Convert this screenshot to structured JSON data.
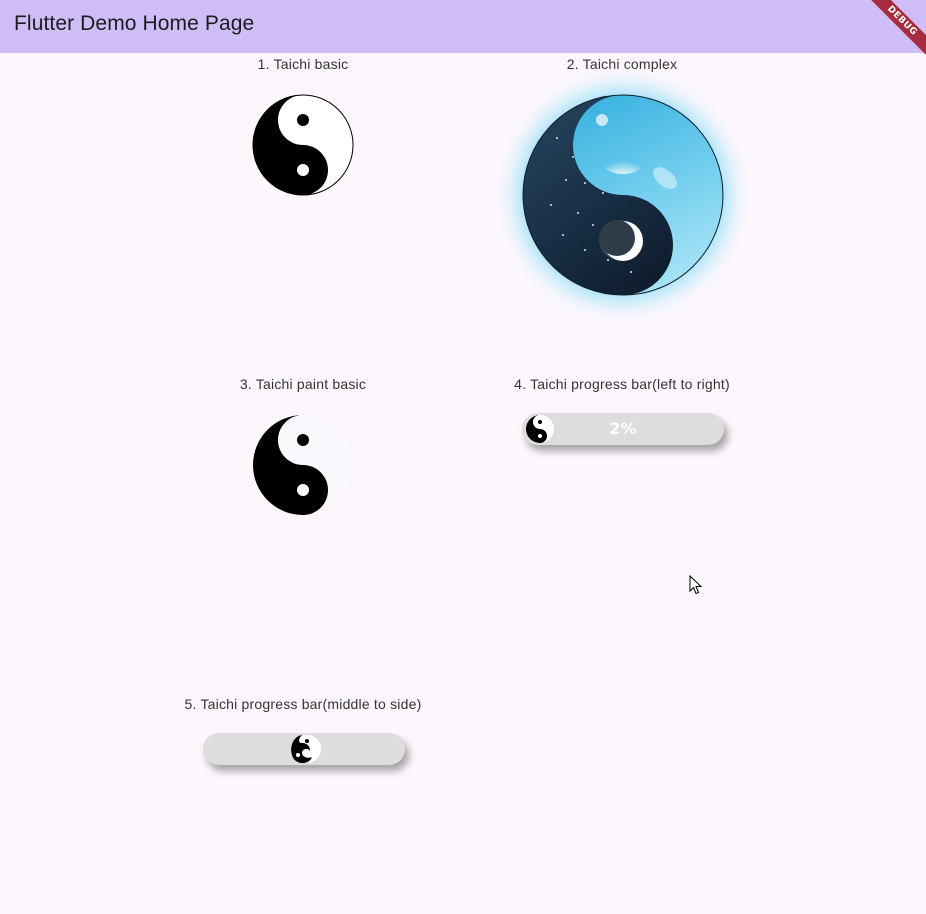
{
  "appbar": {
    "title": "Flutter Demo Home Page"
  },
  "debug_banner": {
    "text": "DEBUG"
  },
  "examples": [
    {
      "label": "1. Taichi basic"
    },
    {
      "label": "2. Taichi complex"
    },
    {
      "label": "3. Taichi paint basic"
    },
    {
      "label": "4. Taichi progress bar(left to right)",
      "progress_text": "2%",
      "progress": 0.02
    },
    {
      "label": "5. Taichi progress bar(middle to side)"
    }
  ],
  "colors": {
    "appbar": "#cfbdf7",
    "background": "#fdf7fd",
    "bar_track": "#dedcde",
    "debug_ribbon": "#a62d3f"
  }
}
